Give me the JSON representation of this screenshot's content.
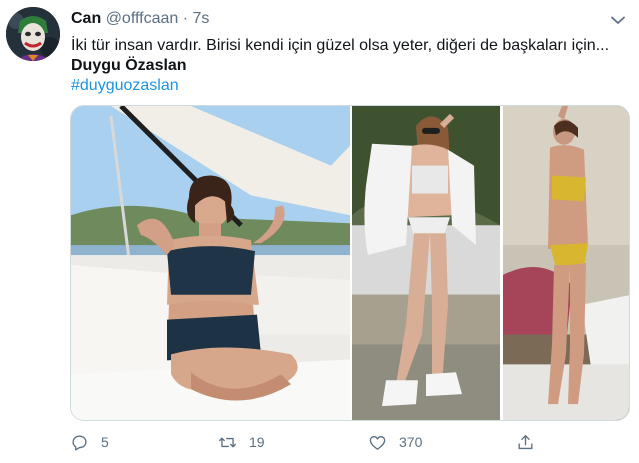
{
  "tweet": {
    "author_name": "Can",
    "author_handle": "@offfcaan",
    "separator": "·",
    "time": "7s",
    "text": "İki tür insan vardır. Birisi kendi için güzel olsa yeter,  diğeri de başkaları için...",
    "mention_name": "Duygu Özaslan",
    "hashtag": "#duyguozaslan"
  },
  "actions": {
    "reply_count": "5",
    "retweet_count": "19",
    "like_count": "370"
  },
  "colors": {
    "link": "#1b95e0",
    "muted": "#5b7083",
    "text": "#0f1419"
  },
  "icons": [
    "avatar-joker",
    "chevron-down-icon",
    "reply-icon",
    "retweet-icon",
    "like-icon",
    "share-icon"
  ]
}
